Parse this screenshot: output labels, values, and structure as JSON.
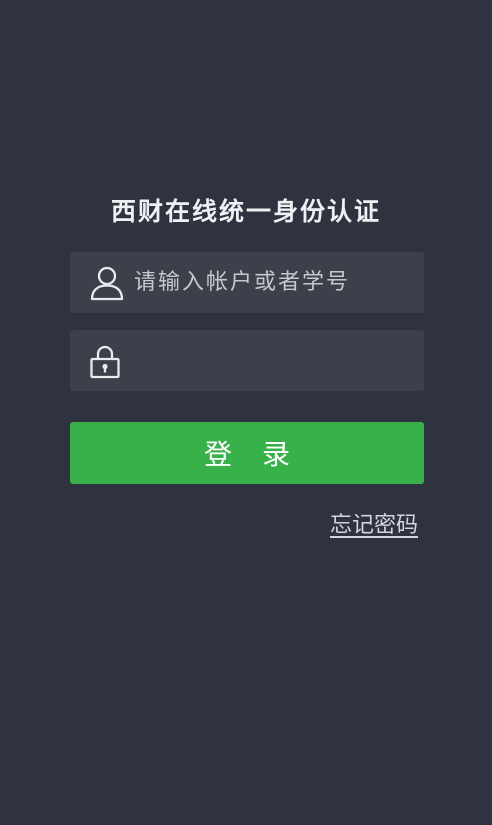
{
  "app": {
    "title": "西财在线统一身份认证"
  },
  "login_form": {
    "username_placeholder": "请输入帐户或者学号",
    "username_value": "",
    "password_placeholder": "",
    "password_value": "",
    "login_label": "登录",
    "forgot_label": "忘记密码"
  },
  "icons": {
    "username": "user-icon",
    "password": "lock-icon"
  },
  "colors": {
    "background": "#2f3340",
    "field_background": "#3c404b",
    "login_button": "#39b14a",
    "text": "#eef0f3"
  }
}
